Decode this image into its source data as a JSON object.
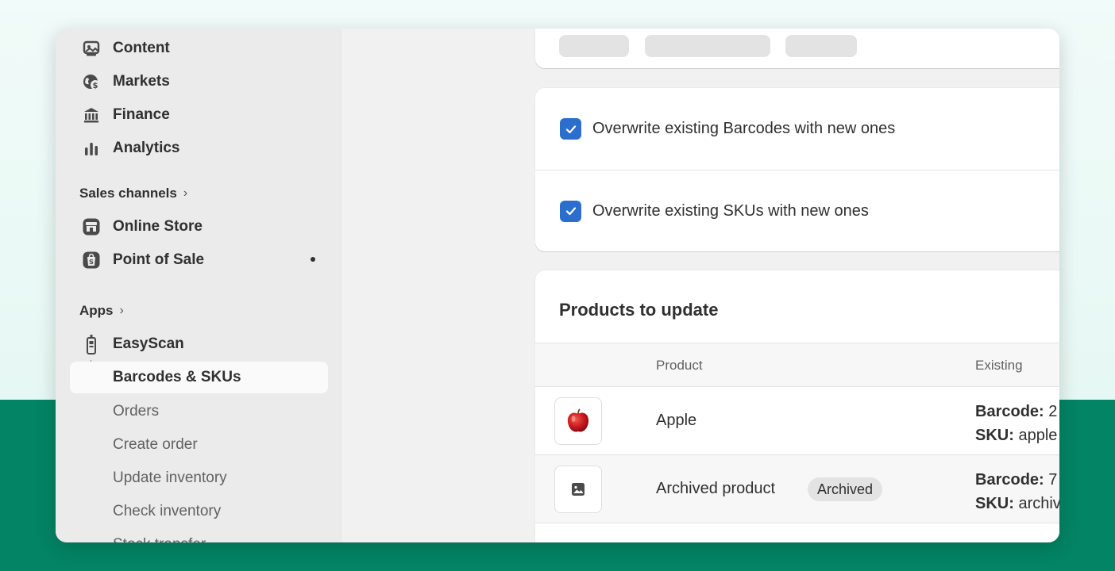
{
  "sidebar": {
    "items": [
      {
        "label": "Content",
        "icon": "content-icon"
      },
      {
        "label": "Markets",
        "icon": "globe-dollar-icon"
      },
      {
        "label": "Finance",
        "icon": "bank-icon"
      },
      {
        "label": "Analytics",
        "icon": "bar-chart-icon"
      }
    ],
    "sales_channels_label": "Sales channels",
    "channels": [
      {
        "label": "Online Store",
        "icon": "store-icon"
      },
      {
        "label": "Point of Sale",
        "icon": "shopping-bag-icon"
      }
    ],
    "apps_label": "Apps",
    "app": {
      "label": "EasyScan",
      "icon": "easyscan-icon"
    },
    "active_sub": "Barcodes & SKUs",
    "sub_items": [
      "Orders",
      "Create order",
      "Update inventory",
      "Check inventory",
      "Stock transfer"
    ]
  },
  "options": {
    "overwrite_barcodes": "Overwrite existing Barcodes with new ones",
    "overwrite_skus": "Overwrite existing SKUs with new ones"
  },
  "products": {
    "title": "Products to update",
    "columns": {
      "product": "Product",
      "existing": "Existing"
    },
    "rows": [
      {
        "name": "Apple",
        "barcode_label": "Barcode:",
        "barcode": "2",
        "sku_label": "SKU:",
        "sku": "apple"
      },
      {
        "name": "Archived product",
        "badge": "Archived",
        "barcode_label": "Barcode:",
        "barcode": "7",
        "sku_label": "SKU:",
        "sku": "archiv"
      }
    ]
  },
  "colors": {
    "accent": "#2c6ecb",
    "background_green": "#038464"
  }
}
